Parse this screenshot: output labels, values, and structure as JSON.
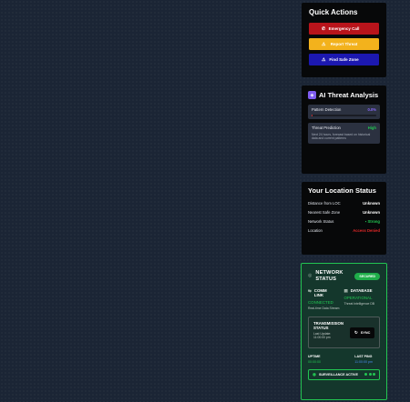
{
  "quick_actions": {
    "title": "Quick Actions",
    "buttons": [
      {
        "label": "Emergency Call",
        "icon": "phone-icon",
        "color": "#b8141b"
      },
      {
        "label": "Report Threat",
        "icon": "warning-icon",
        "color": "#f3b21c"
      },
      {
        "label": "Find Safe Zone",
        "icon": "alert-triangle-icon",
        "color": "#1c18b0"
      }
    ]
  },
  "ai_threat": {
    "title": "AI Threat Analysis",
    "icon": "ai-chip-icon",
    "pattern_detection": {
      "label": "Pattern Detection",
      "value": "0.0%",
      "fill_fraction": 0.02
    },
    "threat_prediction": {
      "label": "Threat Prediction",
      "value": "High",
      "description": "Next 24 hours, forecast based on historical data and current patterns"
    }
  },
  "location": {
    "title": "Your Location Status",
    "rows": [
      {
        "label": "Distance from LOC",
        "value": "Unknown",
        "status": "neutral"
      },
      {
        "label": "Nearest Safe Zone",
        "value": "Unknown",
        "status": "neutral"
      },
      {
        "label": "Network Status",
        "value": "Strong",
        "status": "good"
      },
      {
        "label": "Location",
        "value": "Access Denied",
        "status": "bad"
      }
    ]
  },
  "network": {
    "title": "NETWORK STATUS",
    "badge": "SECURED",
    "comm_link": {
      "title": "COMM LINK",
      "status": "CONNECTED",
      "sub": "Real-time Data Stream"
    },
    "database": {
      "title": "DATABASE",
      "status": "OPERATIONAL",
      "sub": "Threat Intelligence DB"
    },
    "transmission": {
      "title": "TRANSMISSION STATUS",
      "sub": "Last Update: 11:00:00 pm",
      "button": "SYNC"
    },
    "uptime": {
      "label": "UPTIME",
      "value": "00:00:00"
    },
    "last_ping": {
      "label": "LAST PING",
      "value": "11:00:00 pm"
    },
    "surveillance": {
      "label": "SURVEILLANCE ACTIVE"
    }
  }
}
